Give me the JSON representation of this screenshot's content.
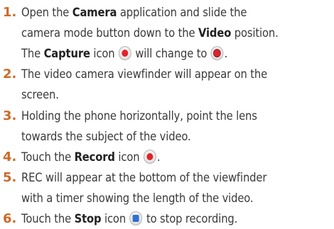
{
  "steps": [
    {
      "number": "1.",
      "lines": [
        {
          "t1": "Open the ",
          "b1": "Camera",
          "t2": " application and slide the"
        },
        {
          "t1": "camera mode button down to the ",
          "b1": "Video",
          "t2": " position."
        },
        {
          "t1": "The ",
          "b1": "Capture",
          "t2": " icon ",
          "t3": " will change to ",
          "t4": "."
        }
      ]
    },
    {
      "number": "2.",
      "lines": [
        {
          "t1": "The video camera viewfinder will appear on the"
        },
        {
          "t1": "screen."
        }
      ]
    },
    {
      "number": "3.",
      "lines": [
        {
          "t1": "Holding the phone horizontally, point the lens"
        },
        {
          "t1": "towards the subject of the video."
        }
      ]
    },
    {
      "number": "4.",
      "lines": [
        {
          "t1": "Touch the ",
          "b1": "Record",
          "t2": " icon ",
          "t3": "."
        }
      ]
    },
    {
      "number": "5.",
      "lines": [
        {
          "t1": "REC will appear at the bottom of the viewfinder"
        },
        {
          "t1": "with a timer showing the length of the video."
        }
      ]
    },
    {
      "number": "6.",
      "lines": [
        {
          "t1": "Touch the ",
          "b1": "Stop",
          "t2": " icon ",
          "t3": " to stop recording."
        }
      ]
    }
  ],
  "icons": {
    "capture": "record-red-dot-icon",
    "video": "record-red-dot-icon",
    "record": "record-red-dot-icon",
    "stop": "stop-blue-square-icon"
  },
  "colors": {
    "number": "#cc6a2a",
    "text": "#3a3a3a",
    "record_red": "#e2232a",
    "stop_blue": "#2f6fd0"
  }
}
